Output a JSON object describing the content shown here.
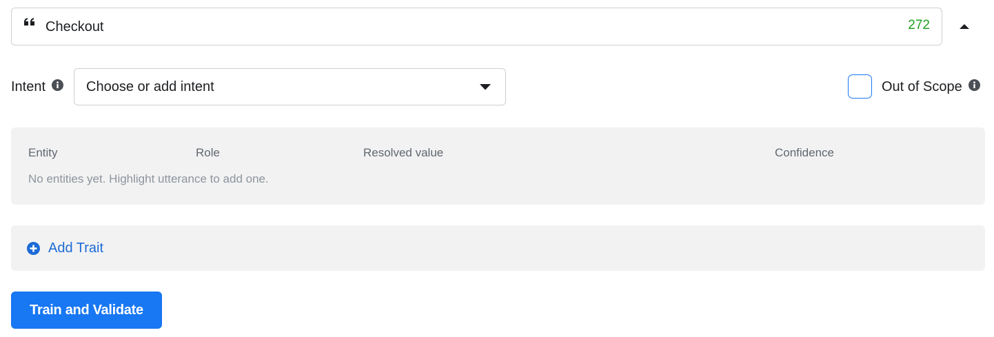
{
  "utterance": {
    "icon": "quote-icon",
    "text": "Checkout",
    "count": "272",
    "count_color": "#1ca01c",
    "collapse_icon": "caret-up-icon"
  },
  "intent": {
    "label": "Intent",
    "info_icon": "info-icon",
    "select_placeholder": "Choose or add intent",
    "select_icon": "caret-down-icon"
  },
  "out_of_scope": {
    "label": "Out of Scope",
    "checked": false,
    "info_icon": "info-icon"
  },
  "entities": {
    "columns": [
      "Entity",
      "Role",
      "Resolved value",
      "Confidence"
    ],
    "empty_message": "No entities yet. Highlight utterance to add one."
  },
  "traits": {
    "add_label": "Add Trait",
    "add_icon": "plus-circle-icon",
    "link_color": "#1c6ad6"
  },
  "actions": {
    "train_label": "Train and Validate",
    "accent_color": "#1877f2"
  }
}
